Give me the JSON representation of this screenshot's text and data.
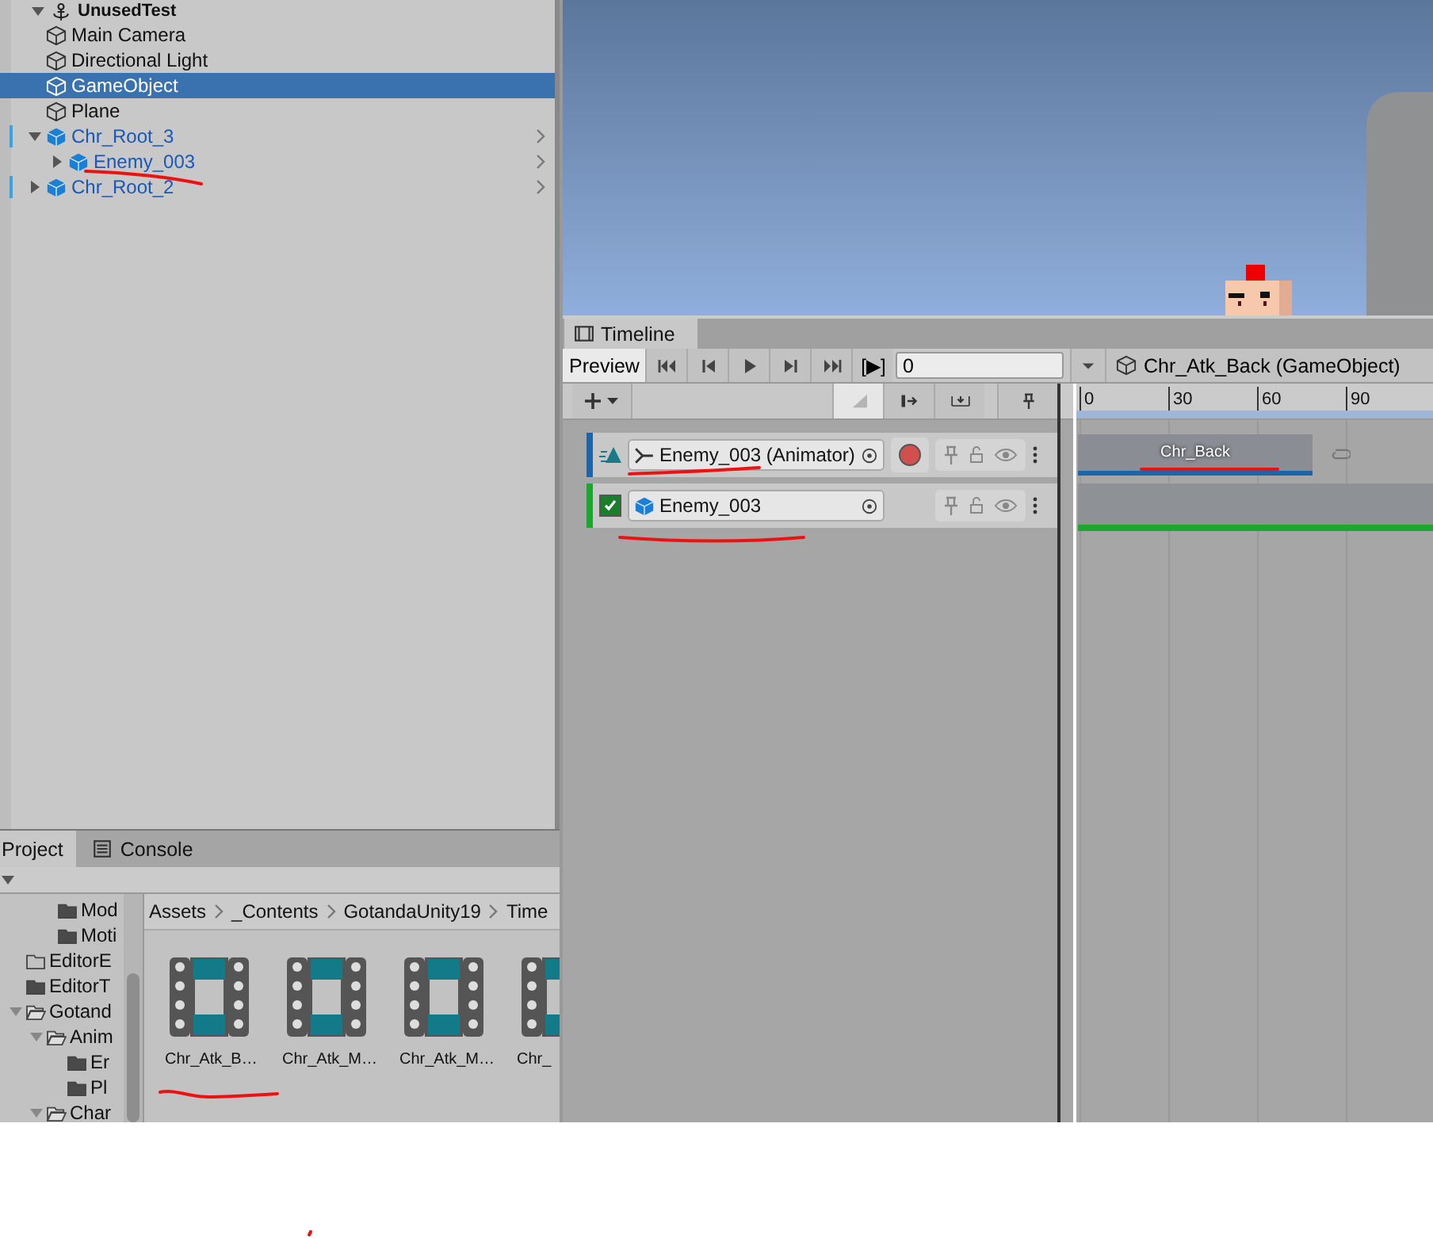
{
  "hierarchy": {
    "scene": "UnusedTest",
    "items": [
      {
        "label": "Main Camera",
        "kind": "object",
        "selected": false
      },
      {
        "label": "Directional Light",
        "kind": "object",
        "selected": false
      },
      {
        "label": "GameObject",
        "kind": "object",
        "selected": true
      },
      {
        "label": "Plane",
        "kind": "object",
        "selected": false
      },
      {
        "label": "Chr_Root_3",
        "kind": "prefab",
        "selected": false,
        "expanded": true,
        "children": [
          {
            "label": "Enemy_003",
            "kind": "prefab",
            "selected": false,
            "expanded": false
          }
        ]
      },
      {
        "label": "Chr_Root_2",
        "kind": "prefab",
        "selected": false,
        "expanded": false
      }
    ]
  },
  "timeline": {
    "tab": "Timeline",
    "preview": {
      "label": "Preview",
      "on": true
    },
    "play_range": "[▶]",
    "frame": "0",
    "binding": "Chr_Atk_Back (GameObject)",
    "ruler": [
      "0",
      "30",
      "60",
      "90"
    ],
    "tracks": [
      {
        "kind": "animation",
        "binding": "Enemy_003 (Animator)",
        "color": "#1d64a8",
        "clip": "Chr_Back"
      },
      {
        "kind": "activation",
        "binding": "Enemy_003",
        "color": "#1aa82c",
        "checked": true
      }
    ]
  },
  "project": {
    "tabs": [
      {
        "label": "Project",
        "selected": true
      },
      {
        "label": "Console",
        "selected": false
      }
    ],
    "deeper_folders": [
      {
        "label": "Mod",
        "kind": "filled"
      },
      {
        "label": "Moti",
        "kind": "filled"
      }
    ],
    "folders": [
      {
        "label": "EditorE",
        "kind": "empty",
        "expanded": false
      },
      {
        "label": "EditorT",
        "kind": "filled",
        "expanded": false
      },
      {
        "label": "Gotand",
        "kind": "filled",
        "expanded": true,
        "children": [
          {
            "label": "Anim",
            "kind": "filled",
            "expanded": true,
            "children": [
              {
                "label": "Er",
                "kind": "filled",
                "expanded": false
              },
              {
                "label": "Pl",
                "kind": "filled",
                "expanded": false
              }
            ]
          },
          {
            "label": "Char",
            "kind": "filled",
            "expanded": true
          }
        ]
      }
    ],
    "breadcrumbs": [
      "Assets",
      "_Contents",
      "GotandaUnity19",
      "Time"
    ],
    "assets": [
      "Chr_Atk_B…",
      "Chr_Atk_M…",
      "Chr_Atk_M…",
      "Chr_"
    ]
  }
}
